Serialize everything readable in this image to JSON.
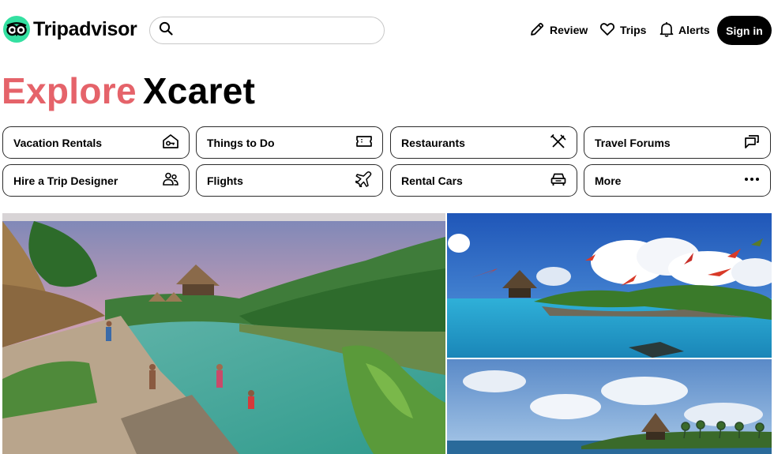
{
  "brand": {
    "name": "Tripadvisor",
    "accent": "#34e0a1"
  },
  "search": {
    "placeholder": "",
    "value": ""
  },
  "nav": {
    "review": {
      "label": "Review",
      "icon": "pencil-icon"
    },
    "trips": {
      "label": "Trips",
      "icon": "heart-icon"
    },
    "alerts": {
      "label": "Alerts",
      "icon": "bell-icon"
    },
    "signin": {
      "label": "Sign in"
    }
  },
  "page": {
    "title_part1": "Explore",
    "title_part2": "Xcaret",
    "title_accent": "#e5636a"
  },
  "categories": [
    {
      "label": "Vacation Rentals",
      "icon": "house-key-icon"
    },
    {
      "label": "Things to Do",
      "icon": "ticket-icon"
    },
    {
      "label": "Restaurants",
      "icon": "utensils-icon"
    },
    {
      "label": "Travel Forums",
      "icon": "chat-bubbles-icon"
    },
    {
      "label": "Hire a Trip Designer",
      "icon": "people-icon"
    },
    {
      "label": "Flights",
      "icon": "airplane-icon"
    },
    {
      "label": "Rental Cars",
      "icon": "car-icon"
    },
    {
      "label": "More",
      "icon": "ellipsis-icon"
    }
  ],
  "gallery": [
    {
      "subject": "Xcaret lagoon with thatched huts and swimmers"
    },
    {
      "subject": "Scarlet macaws flying over tropical lagoon"
    },
    {
      "subject": "Thatched palapa on island under blue sky"
    }
  ]
}
